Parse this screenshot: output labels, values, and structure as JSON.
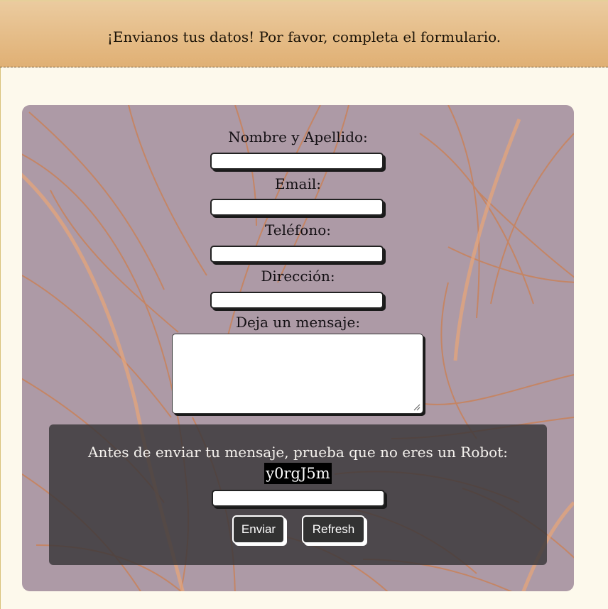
{
  "header": {
    "text": "¡Envianos tus datos! Por favor, completa el formulario."
  },
  "form": {
    "name_label": "Nombre y Apellido:",
    "name_value": "",
    "email_label": "Email:",
    "email_value": "",
    "phone_label": "Teléfono:",
    "phone_value": "",
    "address_label": "Dirección:",
    "address_value": "",
    "message_label": "Deja un mensaje:",
    "message_value": ""
  },
  "captcha": {
    "prompt": "Antes de enviar tu mensaje, prueba que no eres un Robot:",
    "code": "y0rgJ5m",
    "input_value": "",
    "submit_label": "Enviar",
    "refresh_label": "Refresh"
  },
  "colors": {
    "header_bg": "#e0b074",
    "page_bg": "#fdf9ec",
    "panel_bg": "#ad9aa6",
    "leaf_lines": "#c9825a",
    "captcha_bg": "#3a383a",
    "button_bg": "#323232"
  }
}
